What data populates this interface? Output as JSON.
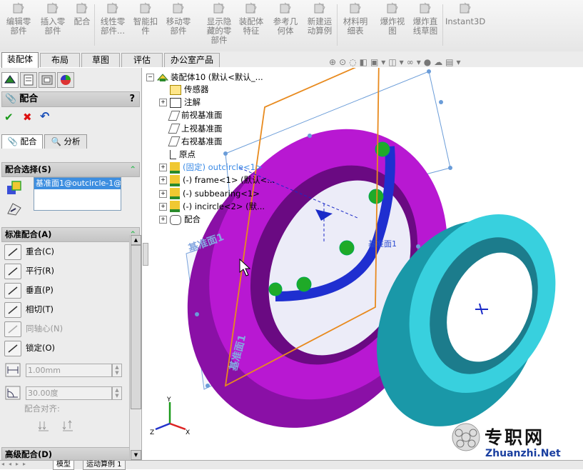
{
  "toolbar": {
    "items": [
      {
        "label": "编辑零\n部件",
        "icon": "edit-part-icon"
      },
      {
        "label": "插入零\n部件",
        "icon": "insert-part-icon"
      },
      {
        "label": "配合",
        "icon": "mate-icon"
      },
      {
        "label": "线性零\n部件...",
        "icon": "linear-pattern-icon"
      },
      {
        "label": "智能扣\n件",
        "icon": "smart-fastener-icon"
      },
      {
        "label": "移动零\n部件",
        "icon": "move-component-icon"
      },
      {
        "label": "显示隐\n藏的零\n部件",
        "icon": "show-hidden-icon"
      },
      {
        "label": "装配体\n特征",
        "icon": "assembly-feature-icon"
      },
      {
        "label": "参考几\n何体",
        "icon": "reference-geometry-icon"
      },
      {
        "label": "新建运\n动算例",
        "icon": "new-motion-study-icon"
      },
      {
        "label": "材料明\n细表",
        "icon": "bom-icon"
      },
      {
        "label": "爆炸视\n图",
        "icon": "exploded-view-icon"
      },
      {
        "label": "爆炸直\n线草图",
        "icon": "explode-line-sketch-icon"
      },
      {
        "label": "Instant3D",
        "icon": "instant3d-icon"
      }
    ]
  },
  "tabs": [
    "装配体",
    "布局",
    "草图",
    "评估",
    "办公室产品"
  ],
  "property_manager": {
    "title": "配合",
    "help": "?",
    "ok": "✔",
    "cancel": "✖",
    "undo": "↶",
    "subtabs": [
      "配合",
      "分析"
    ],
    "mate_selection": {
      "header": "配合选择(S)",
      "selected_item": "基准面1@outcircle-1@"
    },
    "standard_mates": {
      "header": "标准配合(A)",
      "options": [
        {
          "label": "重合(C)",
          "enabled": true
        },
        {
          "label": "平行(R)",
          "enabled": true
        },
        {
          "label": "垂直(P)",
          "enabled": true
        },
        {
          "label": "相切(T)",
          "enabled": true
        },
        {
          "label": "同轴心(N)",
          "enabled": false
        },
        {
          "label": "锁定(O)",
          "enabled": true
        }
      ],
      "distance_value": "1.00mm",
      "angle_value": "30.00度",
      "alignment_label": "配合对齐:"
    },
    "advanced_mates": {
      "header": "高级配合(D)"
    }
  },
  "feature_tree": {
    "root": "装配体10  (默认<默认_...",
    "items": [
      {
        "label": "传感器",
        "expand": false,
        "icon": "sensor-icon"
      },
      {
        "label": "注解",
        "expand": true,
        "icon": "annotation-icon"
      },
      {
        "label": "前视基准面",
        "expand": false,
        "icon": "plane-icon"
      },
      {
        "label": "上视基准面",
        "expand": false,
        "icon": "plane-icon"
      },
      {
        "label": "右视基准面",
        "expand": false,
        "icon": "plane-icon"
      },
      {
        "label": "原点",
        "expand": false,
        "icon": "origin-icon"
      },
      {
        "label": "(固定) outcircle<1>",
        "expand": true,
        "icon": "part-icon"
      },
      {
        "label": "(-) frame<1> (默认<...",
        "expand": true,
        "icon": "part-icon"
      },
      {
        "label": "(-) subbearing<1>",
        "expand": true,
        "icon": "part-icon"
      },
      {
        "label": "(-) incircle<2> (默...",
        "expand": true,
        "icon": "part-icon"
      },
      {
        "label": "配合",
        "expand": true,
        "icon": "mates-folder-icon"
      }
    ]
  },
  "viewport": {
    "plane_label_1": "基准面1",
    "plane_label_2": "基准面1",
    "plane_label_3": "基准面1",
    "triad": {
      "x": "X",
      "y": "Y",
      "z": "Z"
    }
  },
  "watermark": {
    "cn": "专职网",
    "url": "Zhuanzhi.Net"
  },
  "bottom_tabs": [
    "模型",
    "运动算例 1"
  ],
  "colors": {
    "outer_ring": "#a414c0",
    "inner_ring": "#26c2cc",
    "balls": "#22b22a",
    "cage": "#1d2cd4",
    "plane": "#e88a1e"
  }
}
